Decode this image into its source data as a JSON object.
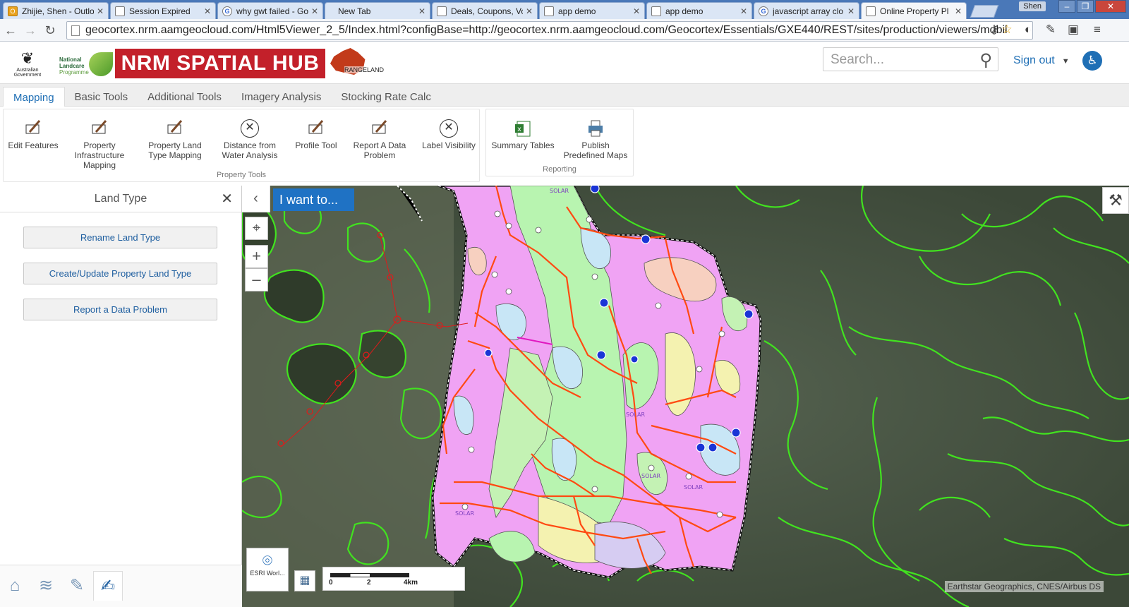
{
  "browser": {
    "tabs": [
      {
        "title": "Zhijie, Shen - Outlo",
        "favicon": "outlook-icon"
      },
      {
        "title": "Session Expired",
        "favicon": "page-icon"
      },
      {
        "title": "why gwt failed - Go",
        "favicon": "google-icon"
      },
      {
        "title": "New Tab",
        "favicon": "none"
      },
      {
        "title": "Deals, Coupons, Vo",
        "favicon": "page-icon"
      },
      {
        "title": "app demo",
        "favicon": "page-icon"
      },
      {
        "title": "app demo",
        "favicon": "page-icon"
      },
      {
        "title": "javascript array clo",
        "favicon": "google-icon"
      },
      {
        "title": "Online Property Pl",
        "favicon": "page-icon",
        "active": true
      }
    ],
    "user": "Shen",
    "url": "geocortex.nrm.aamgeocloud.com/Html5Viewer_2_5/Index.html?configBase=http://geocortex.nrm.aamgeocloud.com/Geocortex/Essentials/GXE440/REST/sites/production/viewers/mobil"
  },
  "header": {
    "gov_label": "Australian Government",
    "nlp_line1": "National",
    "nlp_line2": "Landcare",
    "nlp_line3": "Programme",
    "hub_title": "NRM SPATIAL HUB",
    "rangeland_label": "RANGELAND",
    "search_placeholder": "Search...",
    "sign_out": "Sign out"
  },
  "ribbon": {
    "tabs": [
      "Mapping",
      "Basic Tools",
      "Additional Tools",
      "Imagery Analysis",
      "Stocking Rate Calc"
    ],
    "property_tools": {
      "title": "Property Tools",
      "buttons": [
        "Edit Features",
        "Property Infrastructure Mapping",
        "Property Land Type Mapping",
        "Distance from Water Analysis",
        "Profile Tool",
        "Report A Data Problem",
        "Label Visibility"
      ]
    },
    "reporting": {
      "title": "Reporting",
      "buttons": [
        "Summary Tables",
        "Publish Predefined Maps"
      ]
    }
  },
  "panel": {
    "title": "Land Type",
    "buttons": [
      "Rename Land Type",
      "Create/Update Property Land Type",
      "Report a Data Problem"
    ]
  },
  "map": {
    "i_want_to": "I want to...",
    "basemap_label": "ESRI Worl...",
    "scale_labels": [
      "0",
      "2",
      "4km"
    ],
    "attribution": "Earthstar Geographics, CNES/Airbus DS",
    "map_labels": [
      "SOLAR",
      "SOLAR",
      "SOLAR",
      "SOLAR",
      "SOLAR"
    ],
    "colors": {
      "boundary_green": "#41e31f",
      "landtype_pink": "#f0a3f4",
      "landtype_light_green": "#b8f4b0",
      "landtype_light_blue": "#c8e6f6",
      "road_orange": "#ff4a12",
      "imagery_dark": "#4d5b47"
    }
  }
}
